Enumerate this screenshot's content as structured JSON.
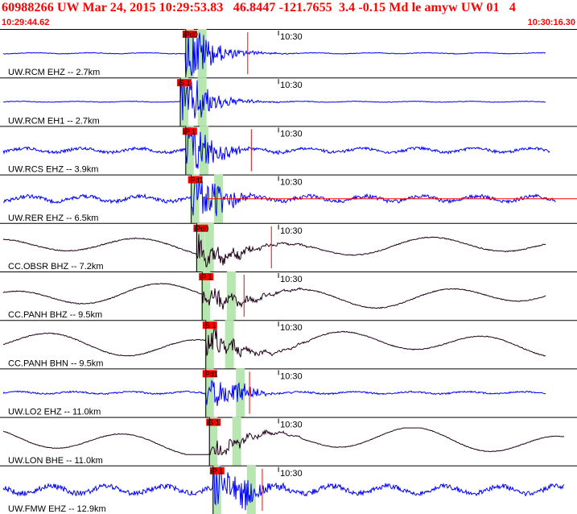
{
  "header": {
    "title": "60988266 UW Mar 24, 2015 10:29:53.83   46.8447 -121.7655  3.4 -0.15 Md le amyw UW 01   4",
    "time_start": "10:29:44.62",
    "time_end": "10:30:16.30"
  },
  "colors": {
    "header": "#ff0000",
    "trace_blue": "#0000ff",
    "trace_dark": "#20001a",
    "pick_window": "#b8e6b0",
    "pick_box": "#ff0000",
    "separator": "#000000"
  },
  "chart_data": {
    "type": "line",
    "title": "60988266 UW Mar 24, 2015 10:29:53.83   46.8447 -121.7655  3.4 -0.15 Md le amyw UW 01   4",
    "time_start": "10:29:44.62",
    "time_end": "10:30:16.30",
    "time_tick_label": "10:30",
    "time_tick_seconds": 15.38,
    "duration_seconds": 31.68,
    "grid": false,
    "traces": [
      {
        "label": "UW.RCM EHZ -- 2.7km",
        "pick_label": "iPd0",
        "pick_t": 10.2,
        "s_t": 10.9,
        "coda_t": 13.0,
        "end_t": 30.0,
        "color": "blue",
        "kind": "sp",
        "noise": 0.06,
        "amp": 0.95,
        "marker_t": 13.6
      },
      {
        "label": "UW.RCM EH1 -- 2.7km",
        "pick_label": "iS 1",
        "pick_t": 9.9,
        "s_t": 10.9,
        "coda_t": 12.0,
        "end_t": 30.0,
        "color": "blue",
        "kind": "sp",
        "noise": 0.05,
        "amp": 0.95,
        "marker_t": null
      },
      {
        "label": "UW.RCS EHZ -- 3.9km",
        "pick_label": "iP 1",
        "pick_t": 10.2,
        "s_t": 11.0,
        "coda_t": 13.0,
        "end_t": 30.2,
        "color": "blue",
        "kind": "sp",
        "noise": 0.25,
        "amp": 0.95,
        "marker_t": 13.8
      },
      {
        "label": "UW.RER EHZ -- 6.5km",
        "pick_label": "iPd1",
        "pick_t": 10.5,
        "s_t": 11.8,
        "coda_t": 13.0,
        "end_t": 30.5,
        "color": "blue",
        "kind": "sp",
        "noise": 0.32,
        "amp": 0.95,
        "marker_t": null
      },
      {
        "label": "CC.OBSR BHZ -- 7.2km",
        "pick_label": "iPd0",
        "pick_t": 10.8,
        "s_t": 11.3,
        "coda_t": 14.5,
        "end_t": 30.0,
        "color": "dark",
        "kind": "bb",
        "noise": 0.45,
        "amp": 0.8,
        "marker_t": 14.9
      },
      {
        "label": "CC.PANH BHZ -- 9.5km",
        "pick_label": "iP 1",
        "pick_t": 11.1,
        "s_t": 12.5,
        "coda_t": 14.0,
        "end_t": 30.0,
        "color": "dark",
        "kind": "bb",
        "noise": 0.6,
        "amp": 0.7,
        "marker_t": 13.4
      },
      {
        "label": "CC.PANH BHN -- 9.5km",
        "pick_label": "iS 1",
        "pick_t": 11.3,
        "s_t": 12.4,
        "coda_t": 14.0,
        "end_t": 30.0,
        "color": "dark",
        "kind": "bb",
        "noise": 0.6,
        "amp": 0.75,
        "marker_t": null
      },
      {
        "label": "UW.LO2 EHZ -- 11.0km",
        "pick_label": "iPd1",
        "pick_t": 11.3,
        "s_t": 13.0,
        "coda_t": 13.5,
        "end_t": 30.0,
        "color": "blue",
        "kind": "sp",
        "noise": 0.18,
        "amp": 0.7,
        "marker_t": 13.7
      },
      {
        "label": "UW.LON BHE -- 11.0km",
        "pick_label": "iS 1",
        "pick_t": 11.5,
        "s_t": 12.8,
        "coda_t": 14.0,
        "end_t": 31.0,
        "color": "dark",
        "kind": "bb",
        "noise": 0.9,
        "amp": 0.55,
        "marker_t": null
      },
      {
        "label": "UW.FMW EHZ -- 12.9km",
        "pick_label": "iP 1",
        "pick_t": 11.7,
        "s_t": 13.6,
        "coda_t": 14.5,
        "end_t": 31.0,
        "color": "blue",
        "kind": "sp",
        "noise": 0.45,
        "amp": 0.95,
        "marker_t": 14.4
      }
    ]
  }
}
